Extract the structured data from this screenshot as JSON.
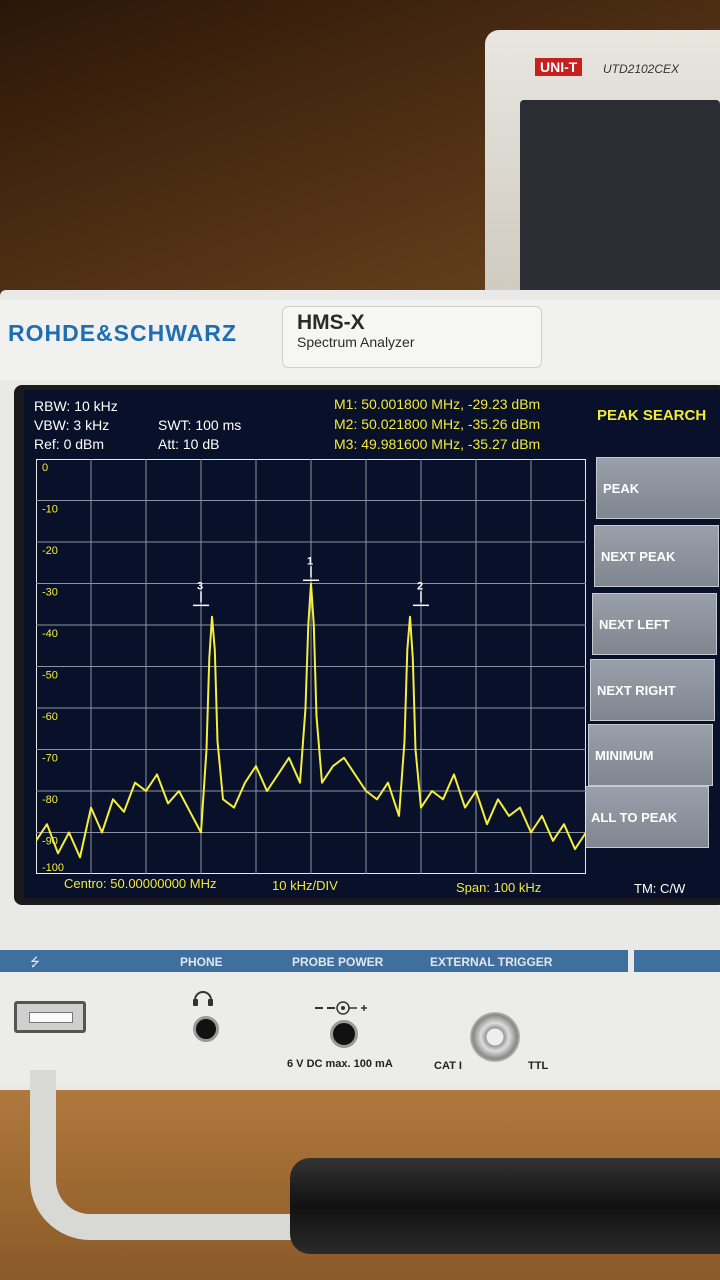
{
  "background": {
    "device_brand": "UNI-T",
    "device_model": "UTD2102CEX"
  },
  "instrument": {
    "brand": "ROHDE&SCHWARZ",
    "model": "HMS-X",
    "subtitle": "Spectrum Analyzer"
  },
  "settings": {
    "rbw": "RBW: 10 kHz",
    "vbw": "VBW: 3 kHz",
    "ref": "Ref: 0 dBm",
    "swt": "SWT: 100 ms",
    "att": "Att: 10 dB"
  },
  "markers": {
    "m1": "M1: 50.001800 MHz, -29.23 dBm",
    "m2": "M2: 50.021800 MHz, -35.26 dBm",
    "m3": "M3: 49.981600 MHz, -35.27 dBm"
  },
  "menu": {
    "title": "PEAK SEARCH",
    "softkeys": [
      "PEAK",
      "NEXT PEAK",
      "NEXT LEFT",
      "NEXT RIGHT",
      "MINIMUM",
      "ALL TO PEAK"
    ]
  },
  "footer": {
    "center": "Centro: 50.00000000 MHz",
    "div": "10 kHz/DIV",
    "span": "Span: 100 kHz",
    "tm": "TM: C/W"
  },
  "front_panel": {
    "phone": "PHONE",
    "probe_power": "PROBE POWER",
    "external_trigger": "EXTERNAL TRIGGER",
    "power_spec": "6 V DC  max. 100 mA",
    "cat": "CAT I",
    "ttl": "TTL"
  },
  "colors": {
    "trace": "#f4ee3c",
    "screen_bg": "#08102a",
    "grid": "#8c93a0",
    "brand_blue": "#1d6fb2"
  },
  "chart_data": {
    "type": "line",
    "x_range_khz_offset": [
      -50,
      50
    ],
    "y_ticks": [
      "0",
      "-10",
      "-20",
      "-30",
      "-40",
      "-50",
      "-60",
      "-70",
      "-80",
      "-90",
      "-100"
    ],
    "ylim": [
      -100,
      0
    ],
    "x_divisions": 10,
    "y_divisions": 10,
    "series": [
      {
        "x": [
          -50,
          -48,
          -46,
          -44,
          -42,
          -40,
          -38,
          -36,
          -34,
          -32,
          -30,
          -28,
          -26,
          -24,
          -22,
          -20,
          -19,
          -18.5,
          -18,
          -17.5,
          -17,
          -16,
          -14,
          -12,
          -10,
          -8,
          -6,
          -4,
          -2,
          -1,
          -0.5,
          0,
          0.5,
          1,
          2,
          4,
          6,
          8,
          10,
          12,
          14,
          16,
          17,
          17.5,
          18,
          18.5,
          19,
          20,
          22,
          24,
          26,
          28,
          30,
          32,
          34,
          36,
          38,
          40,
          42,
          44,
          46,
          48,
          50
        ],
        "y": [
          -92,
          -88,
          -95,
          -90,
          -96,
          -84,
          -90,
          -82,
          -85,
          -78,
          -80,
          -76,
          -83,
          -80,
          -85,
          -90,
          -70,
          -48,
          -38,
          -46,
          -68,
          -82,
          -84,
          -78,
          -74,
          -80,
          -76,
          -72,
          -78,
          -60,
          -40,
          -30,
          -40,
          -62,
          -78,
          -74,
          -72,
          -76,
          -80,
          -82,
          -78,
          -86,
          -68,
          -46,
          -38,
          -48,
          -70,
          -84,
          -80,
          -82,
          -76,
          -84,
          -80,
          -88,
          -82,
          -86,
          -84,
          -90,
          -86,
          -92,
          -88,
          -94,
          -90
        ]
      }
    ],
    "markers": [
      {
        "label": "1",
        "x": 0,
        "y": -29.23
      },
      {
        "label": "2",
        "x": 20,
        "y": -35.26
      },
      {
        "label": "3",
        "x": -20,
        "y": -35.27
      }
    ]
  }
}
